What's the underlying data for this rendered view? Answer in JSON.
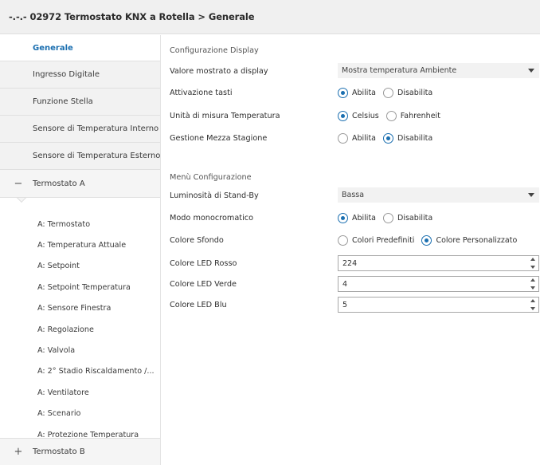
{
  "window": {
    "title": "-.-.- 02972 Termostato KNX a Rotella  > Generale"
  },
  "sidebar": {
    "top_items": [
      {
        "label": "Generale",
        "active": true
      },
      {
        "label": "Ingresso Digitale"
      },
      {
        "label": "Funzione Stella"
      },
      {
        "label": "Sensore di Temperatura Interno"
      },
      {
        "label": "Sensore di Temperatura Esterno"
      }
    ],
    "group_a": {
      "toggle": "−",
      "label": "Termostato A",
      "children": [
        "A: Termostato",
        "A: Temperatura Attuale",
        "A: Setpoint",
        "A: Setpoint Temperatura",
        "A: Sensore Finestra",
        "A: Regolazione",
        "A: Valvola",
        "A: 2° Stadio Riscaldamento /...",
        "A: Ventilatore",
        "A: Scenario",
        "A: Protezione Temperatura"
      ]
    },
    "group_b": {
      "toggle": "+",
      "label": "Termostato B"
    }
  },
  "display_section": {
    "title": "Configurazione Display",
    "valore": {
      "label": "Valore mostrato a display",
      "value": "Mostra temperatura Ambiente"
    },
    "tasti": {
      "label": "Attivazione tasti",
      "options": [
        "Abilita",
        "Disabilita"
      ],
      "selected": 0
    },
    "unita": {
      "label": "Unità di misura Temperatura",
      "options": [
        "Celsius",
        "Fahrenheit"
      ],
      "selected": 0
    },
    "mezza": {
      "label": "Gestione Mezza Stagione",
      "options": [
        "Abilita",
        "Disabilita"
      ],
      "selected": 1
    }
  },
  "menu_section": {
    "title": "Menù Configurazione",
    "luminosita": {
      "label": "Luminosità di Stand-By",
      "value": "Bassa"
    },
    "mono": {
      "label": "Modo monocromatico",
      "options": [
        "Abilita",
        "Disabilita"
      ],
      "selected": 0
    },
    "sfondo": {
      "label": "Colore Sfondo",
      "options": [
        "Colori Predefiniti",
        "Colore Personalizzato"
      ],
      "selected": 1
    },
    "led_rosso": {
      "label": "Colore LED Rosso",
      "value": "224"
    },
    "led_verde": {
      "label": "Colore LED Verde",
      "value": "4"
    },
    "led_blu": {
      "label": "Colore LED Blu",
      "value": "5"
    }
  },
  "colors": {
    "accent": "#1b6fb0",
    "nav_bg": "#f2f2f2",
    "title_bg": "#f0f0f0"
  },
  "icons": {
    "collapse": "minus-icon",
    "expand": "plus-icon",
    "dropdown": "chevron-down-icon",
    "spinner": "spin-arrows-icon"
  }
}
